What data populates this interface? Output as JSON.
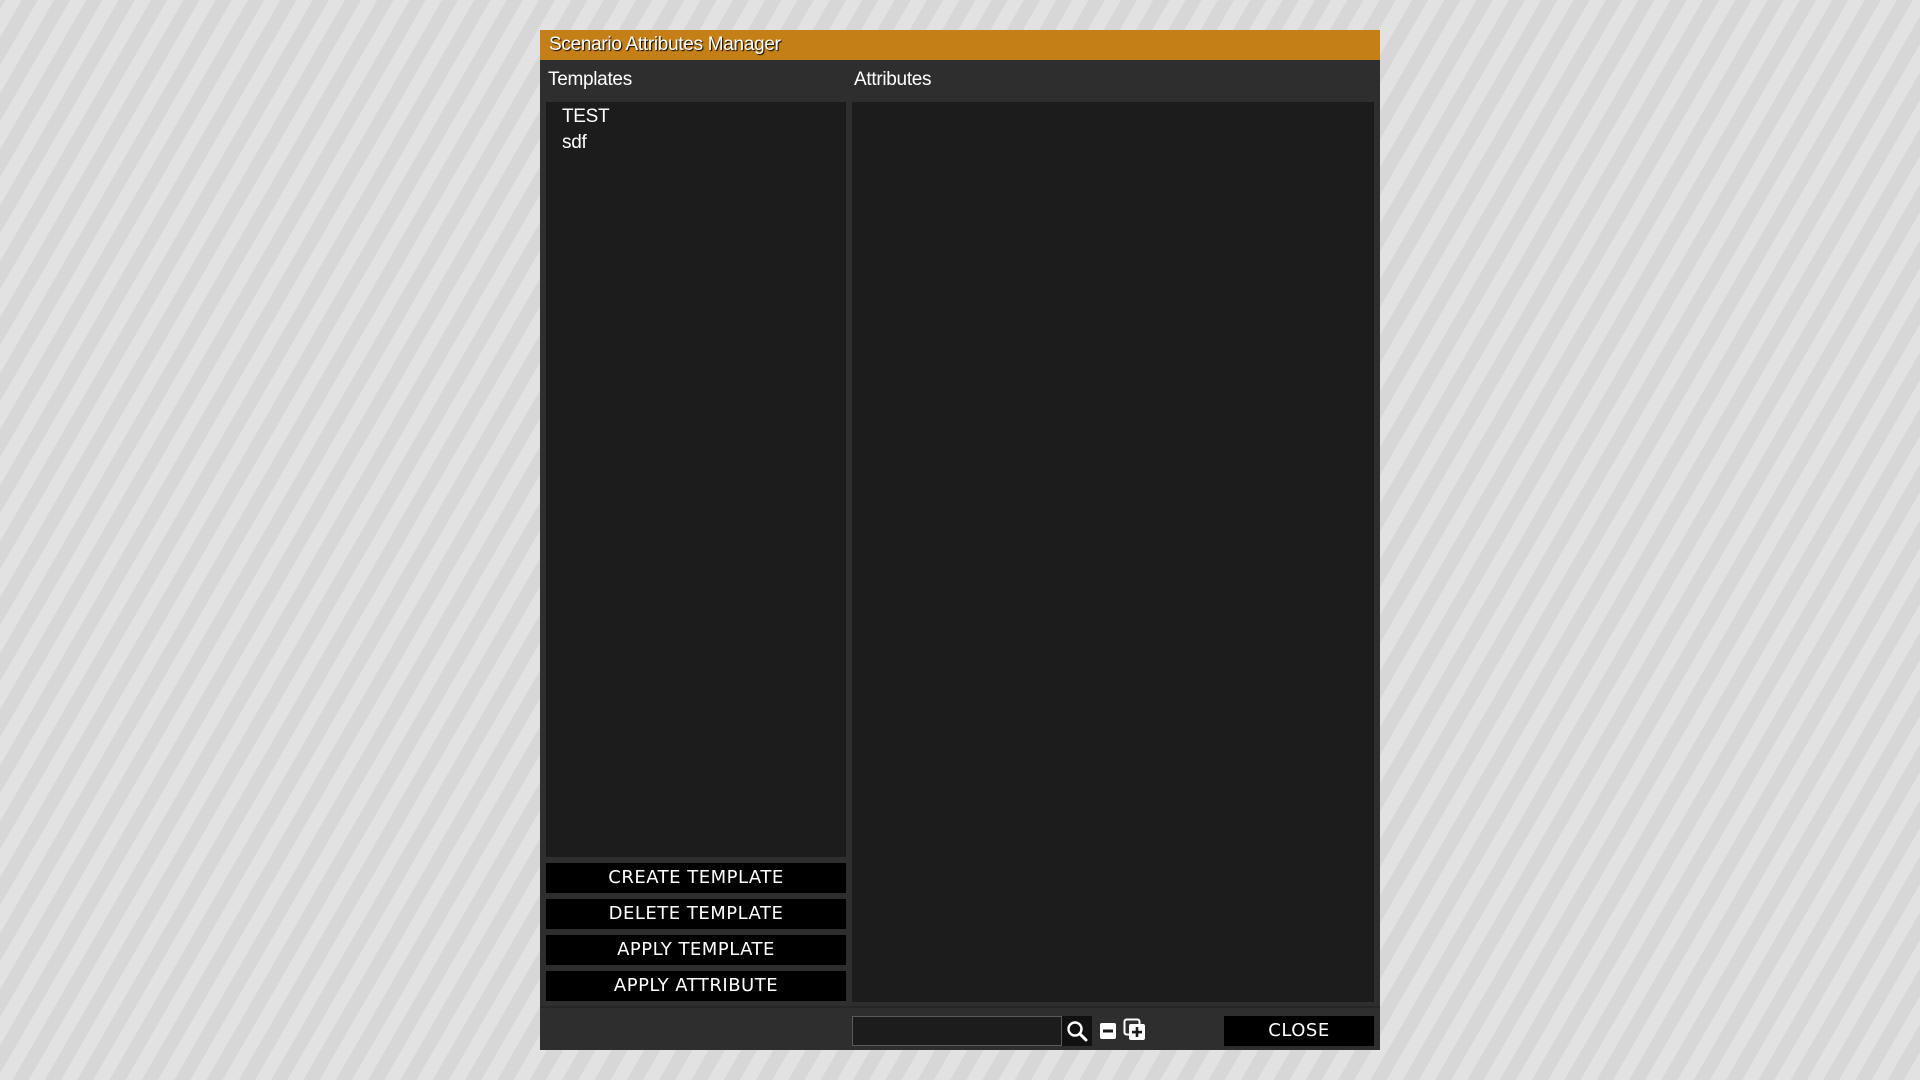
{
  "window": {
    "title": "Scenario Attributes Manager",
    "accent_color": "#c47f17"
  },
  "templates": {
    "header": "Templates",
    "items": [
      "TEST",
      "sdf"
    ]
  },
  "attributes": {
    "header": "Attributes"
  },
  "buttons": {
    "create_template": "CREATE TEMPLATE",
    "delete_template": "DELETE TEMPLATE",
    "apply_template": "APPLY TEMPLATE",
    "apply_attribute": "APPLY ATTRIBUTE",
    "close": "CLOSE"
  },
  "search": {
    "value": "",
    "icon": "search-icon"
  },
  "icons": {
    "collapse": "collapse-all-icon",
    "expand": "expand-all-icon"
  }
}
